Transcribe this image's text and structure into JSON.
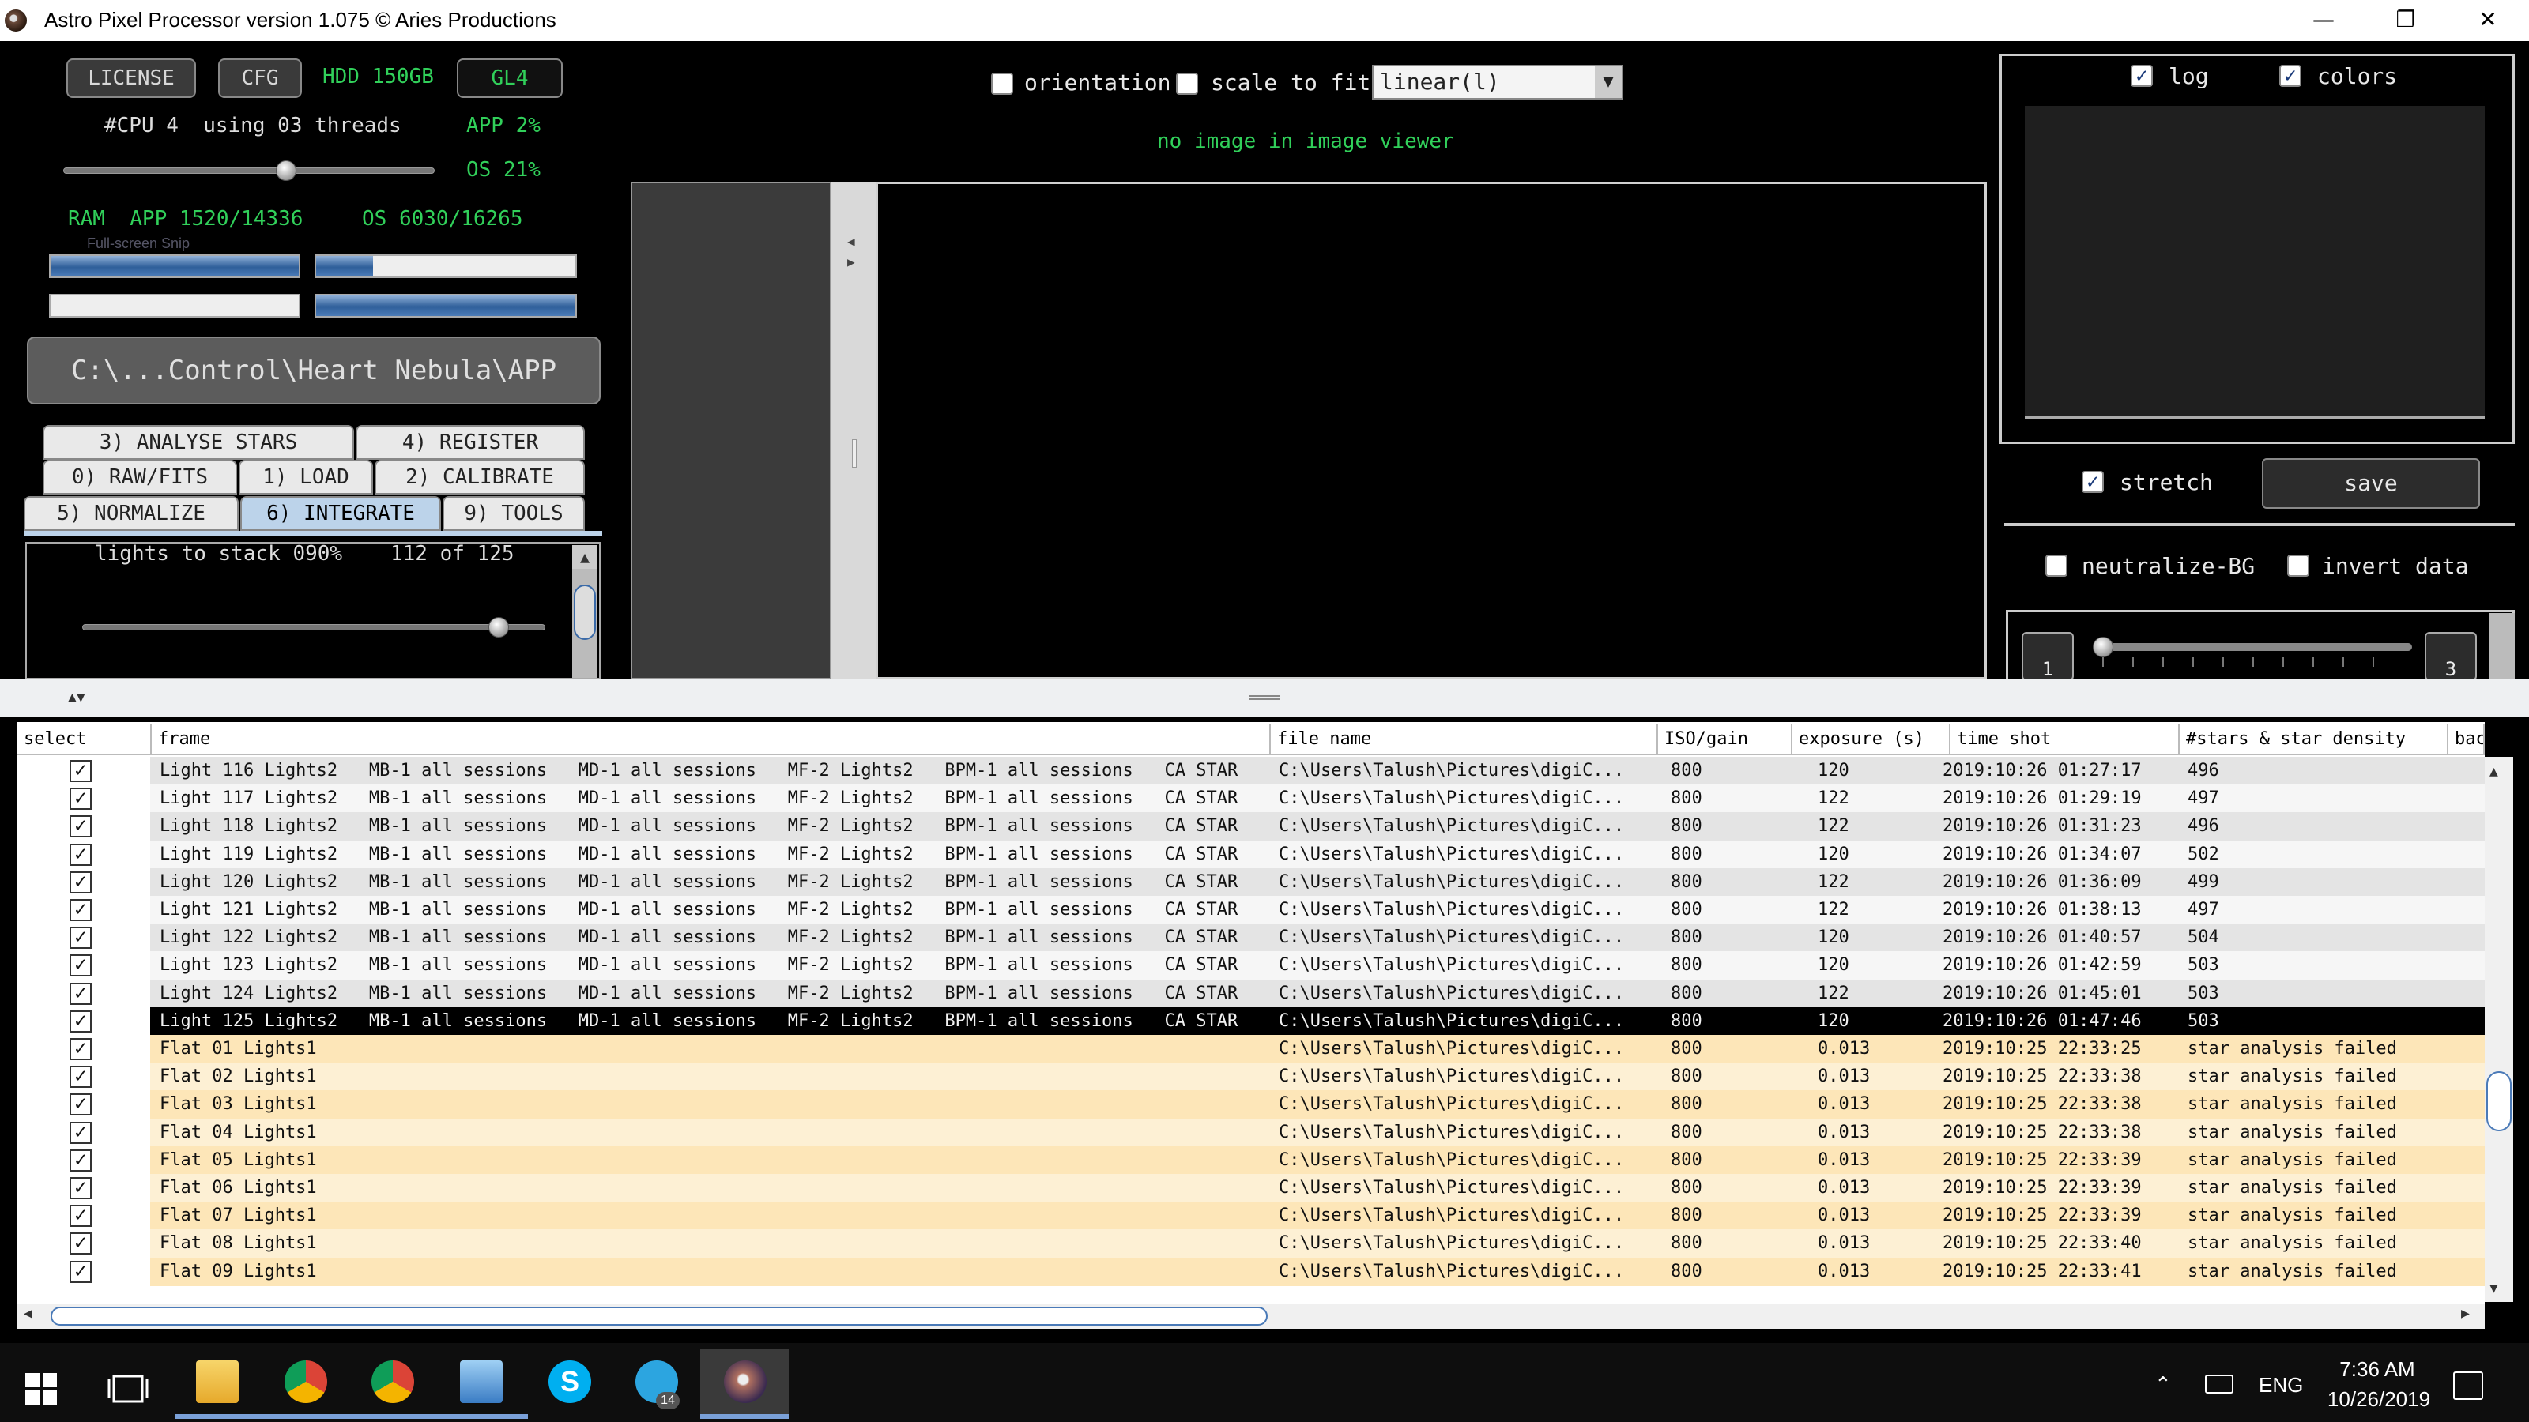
{
  "window": {
    "title": "Astro Pixel Processor version 1.075 © Aries Productions",
    "minimize": "—",
    "restore": "❐",
    "close": "✕"
  },
  "top_left": {
    "license_btn": "LICENSE",
    "cfg_btn": "CFG",
    "hdd_label": "HDD 150GB",
    "gl_btn": "GL4",
    "cpu_label": "#CPU 4  using 03 threads",
    "app_pct": "APP 2%",
    "os_pct": "OS 21%",
    "thread_slider_value": 0.6,
    "ram_label": "RAM  APP 1520/14336",
    "ram_os_label": "OS 6030/16265",
    "ram_app_fill": 1.0,
    "ram_os_fill": 0.22,
    "bar3_fill": 0.0,
    "bar4_fill": 1.0,
    "snip_overlay": "Full-screen Snip"
  },
  "work_dir": "C:\\...Control\\Heart Nebula\\APP",
  "tabs": [
    {
      "label": "3) ANALYSE STARS"
    },
    {
      "label": "4) REGISTER"
    },
    {
      "label": "0) RAW/FITS"
    },
    {
      "label": "1) LOAD"
    },
    {
      "label": "2) CALIBRATE"
    },
    {
      "label": "5) NORMALIZE"
    },
    {
      "label": "6) INTEGRATE",
      "active": true
    },
    {
      "label": "9) TOOLS"
    }
  ],
  "integrate": {
    "lights_to_stack": "lights to stack 090%",
    "count": "112 of 125",
    "slider_value": 0.9
  },
  "viewer": {
    "orientation_label": "orientation",
    "scale_label": "scale to fit",
    "stretch_mode": "linear(l)",
    "no_image": "no image in image viewer"
  },
  "histogram": {
    "log_label": "log",
    "colors_label": "colors",
    "stretch_label": "stretch",
    "save_label": "save",
    "neutralize_label": "neutralize-BG",
    "invert_label": "invert data",
    "range_min": "1",
    "range_max": "3"
  },
  "table": {
    "headers": [
      "select",
      "frame",
      "file name",
      "ISO/gain",
      "exposure (s)",
      "time shot",
      "#stars & star density",
      "back"
    ],
    "rows": [
      {
        "frame": "Light 116 Lights2   MB-1 all sessions   MD-1 all sessions   MF-2 Lights2   BPM-1 all sessions   CA STAR",
        "file": "C:\\Users\\Talush\\Pictures\\digiC...",
        "iso": "800",
        "exp": "120",
        "time": "2019:10:26 01:27:17",
        "stars": "496",
        "type": "light"
      },
      {
        "frame": "Light 117 Lights2   MB-1 all sessions   MD-1 all sessions   MF-2 Lights2   BPM-1 all sessions   CA STAR",
        "file": "C:\\Users\\Talush\\Pictures\\digiC...",
        "iso": "800",
        "exp": "122",
        "time": "2019:10:26 01:29:19",
        "stars": "497",
        "type": "light"
      },
      {
        "frame": "Light 118 Lights2   MB-1 all sessions   MD-1 all sessions   MF-2 Lights2   BPM-1 all sessions   CA STAR",
        "file": "C:\\Users\\Talush\\Pictures\\digiC...",
        "iso": "800",
        "exp": "122",
        "time": "2019:10:26 01:31:23",
        "stars": "496",
        "type": "light"
      },
      {
        "frame": "Light 119 Lights2   MB-1 all sessions   MD-1 all sessions   MF-2 Lights2   BPM-1 all sessions   CA STAR",
        "file": "C:\\Users\\Talush\\Pictures\\digiC...",
        "iso": "800",
        "exp": "120",
        "time": "2019:10:26 01:34:07",
        "stars": "502",
        "type": "light"
      },
      {
        "frame": "Light 120 Lights2   MB-1 all sessions   MD-1 all sessions   MF-2 Lights2   BPM-1 all sessions   CA STAR",
        "file": "C:\\Users\\Talush\\Pictures\\digiC...",
        "iso": "800",
        "exp": "122",
        "time": "2019:10:26 01:36:09",
        "stars": "499",
        "type": "light"
      },
      {
        "frame": "Light 121 Lights2   MB-1 all sessions   MD-1 all sessions   MF-2 Lights2   BPM-1 all sessions   CA STAR",
        "file": "C:\\Users\\Talush\\Pictures\\digiC...",
        "iso": "800",
        "exp": "122",
        "time": "2019:10:26 01:38:13",
        "stars": "497",
        "type": "light"
      },
      {
        "frame": "Light 122 Lights2   MB-1 all sessions   MD-1 all sessions   MF-2 Lights2   BPM-1 all sessions   CA STAR",
        "file": "C:\\Users\\Talush\\Pictures\\digiC...",
        "iso": "800",
        "exp": "120",
        "time": "2019:10:26 01:40:57",
        "stars": "504",
        "type": "light"
      },
      {
        "frame": "Light 123 Lights2   MB-1 all sessions   MD-1 all sessions   MF-2 Lights2   BPM-1 all sessions   CA STAR",
        "file": "C:\\Users\\Talush\\Pictures\\digiC...",
        "iso": "800",
        "exp": "120",
        "time": "2019:10:26 01:42:59",
        "stars": "503",
        "type": "light"
      },
      {
        "frame": "Light 124 Lights2   MB-1 all sessions   MD-1 all sessions   MF-2 Lights2   BPM-1 all sessions   CA STAR",
        "file": "C:\\Users\\Talush\\Pictures\\digiC...",
        "iso": "800",
        "exp": "122",
        "time": "2019:10:26 01:45:01",
        "stars": "503",
        "type": "light"
      },
      {
        "frame": "Light 125 Lights2   MB-1 all sessions   MD-1 all sessions   MF-2 Lights2   BPM-1 all sessions   CA STAR",
        "file": "C:\\Users\\Talush\\Pictures\\digiC...",
        "iso": "800",
        "exp": "120",
        "time": "2019:10:26 01:47:46",
        "stars": "503",
        "type": "light",
        "selected": true
      },
      {
        "frame": "Flat 01 Lights1",
        "file": "C:\\Users\\Talush\\Pictures\\digiC...",
        "iso": "800",
        "exp": "0.013",
        "time": "2019:10:25 22:33:25",
        "stars": "star analysis failed",
        "type": "flat"
      },
      {
        "frame": "Flat 02 Lights1",
        "file": "C:\\Users\\Talush\\Pictures\\digiC...",
        "iso": "800",
        "exp": "0.013",
        "time": "2019:10:25 22:33:38",
        "stars": "star analysis failed",
        "type": "flat"
      },
      {
        "frame": "Flat 03 Lights1",
        "file": "C:\\Users\\Talush\\Pictures\\digiC...",
        "iso": "800",
        "exp": "0.013",
        "time": "2019:10:25 22:33:38",
        "stars": "star analysis failed",
        "type": "flat"
      },
      {
        "frame": "Flat 04 Lights1",
        "file": "C:\\Users\\Talush\\Pictures\\digiC...",
        "iso": "800",
        "exp": "0.013",
        "time": "2019:10:25 22:33:38",
        "stars": "star analysis failed",
        "type": "flat"
      },
      {
        "frame": "Flat 05 Lights1",
        "file": "C:\\Users\\Talush\\Pictures\\digiC...",
        "iso": "800",
        "exp": "0.013",
        "time": "2019:10:25 22:33:39",
        "stars": "star analysis failed",
        "type": "flat"
      },
      {
        "frame": "Flat 06 Lights1",
        "file": "C:\\Users\\Talush\\Pictures\\digiC...",
        "iso": "800",
        "exp": "0.013",
        "time": "2019:10:25 22:33:39",
        "stars": "star analysis failed",
        "type": "flat"
      },
      {
        "frame": "Flat 07 Lights1",
        "file": "C:\\Users\\Talush\\Pictures\\digiC...",
        "iso": "800",
        "exp": "0.013",
        "time": "2019:10:25 22:33:39",
        "stars": "star analysis failed",
        "type": "flat"
      },
      {
        "frame": "Flat 08 Lights1",
        "file": "C:\\Users\\Talush\\Pictures\\digiC...",
        "iso": "800",
        "exp": "0.013",
        "time": "2019:10:25 22:33:40",
        "stars": "star analysis failed",
        "type": "flat"
      },
      {
        "frame": "Flat 09 Lights1",
        "file": "C:\\Users\\Talush\\Pictures\\digiC...",
        "iso": "800",
        "exp": "0.013",
        "time": "2019:10:25 22:33:41",
        "stars": "star analysis failed",
        "type": "flat"
      }
    ]
  },
  "taskbar": {
    "icons": [
      "windows-start-icon",
      "task-view-icon",
      "file-explorer-icon",
      "chrome-icon",
      "chrome-profile-icon",
      "control-panel-icon",
      "skype-icon",
      "telegram-icon",
      "astro-pixel-processor-icon"
    ],
    "telegram_badge": "14",
    "lang": "ENG",
    "time": "7:36 AM",
    "date": "10/26/2019"
  },
  "colors": {
    "green_text": "#31d05a",
    "flat_row": "#fde6b8",
    "selected_row": "#000000",
    "tab_active": "#bcd3ea",
    "progress_fill": "#2f5f9a"
  }
}
